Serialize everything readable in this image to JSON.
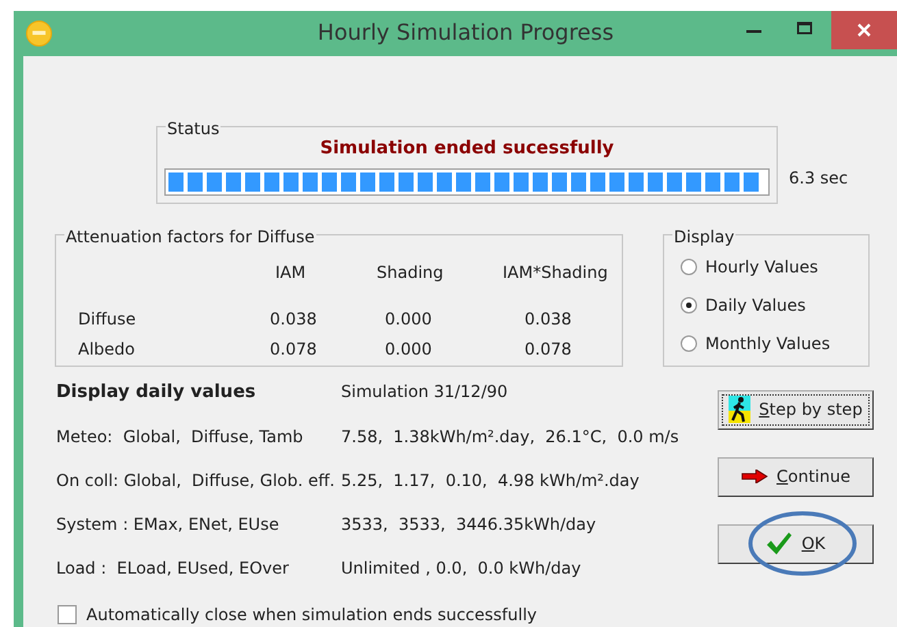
{
  "window": {
    "title": "Hourly Simulation Progress"
  },
  "status": {
    "label": "Status",
    "message": "Simulation ended sucessfully",
    "progress": {
      "level": 1
    },
    "elapsed": "6.3 sec"
  },
  "attenuation": {
    "label": "Attenuation factors for Diffuse",
    "columns": [
      "IAM",
      "Shading",
      "IAM*Shading"
    ],
    "rows": [
      {
        "name": "Diffuse",
        "values": [
          "0.038",
          "0.000",
          "0.038"
        ]
      },
      {
        "name": "Albedo",
        "values": [
          "0.078",
          "0.000",
          "0.078"
        ]
      }
    ]
  },
  "display": {
    "label": "Display",
    "options": [
      {
        "label": "Hourly Values",
        "selected": false
      },
      {
        "label": "Daily Values",
        "selected": true
      },
      {
        "label": "Monthly Values",
        "selected": false
      }
    ]
  },
  "values": {
    "heading": "Display daily values",
    "date": "Simulation 31/12/90",
    "rows": [
      {
        "label": "Meteo:  Global,  Diffuse, Tamb",
        "value": "7.58,  1.38kWh/m².day,  26.1°C,  0.0 m/s"
      },
      {
        "label": "On coll: Global,  Diffuse, Glob. eff.",
        "value": "5.25,  1.17,  0.10,  4.98 kWh/m².day"
      },
      {
        "label": "System : EMax, ENet, EUse",
        "value": "3533,  3533,  3446.35kWh/day"
      },
      {
        "label": "Load :  ELoad, EUsed, EOver",
        "value": "Unlimited , 0.0,  0.0 kWh/day"
      }
    ]
  },
  "buttons": [
    {
      "kind": "step",
      "label": "Step by step",
      "focused": true,
      "circled": false
    },
    {
      "kind": "continue",
      "label": "Continue",
      "focused": false,
      "circled": false
    },
    {
      "kind": "ok",
      "label": "OK",
      "focused": false,
      "circled": true
    }
  ],
  "auto_close": {
    "label": "Automatically close when simulation ends successfully",
    "checked": false
  }
}
